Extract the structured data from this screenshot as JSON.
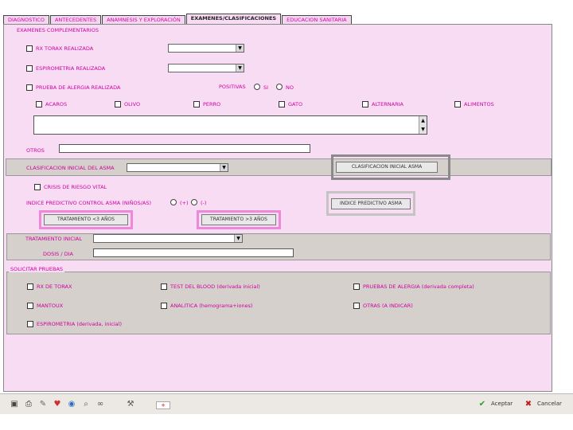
{
  "tabs": [
    {
      "label": "DIAGNOSTICO",
      "active": false
    },
    {
      "label": "ANTECEDENTES",
      "active": false
    },
    {
      "label": "ANAMNESIS Y EXPLORACIÓN",
      "active": false
    },
    {
      "label": "EXAMENES/CLASIFICACIONES",
      "active": true
    },
    {
      "label": "EDUCACION SANITARIA",
      "active": false
    }
  ],
  "examenes": {
    "section_title": "EXAMENES COMPLEMENTARIOS",
    "rx_label": "RX TORAX REALIZADA",
    "espirometria_label": "ESPIROMETRIA REALIZADA",
    "alergia_label": "PRUEBA DE ALERGIA REALIZADA",
    "positivas_label": "POSITIVAS",
    "si_label": "SI",
    "no_label": "NO",
    "alergenos": [
      "ACAROS",
      "OLIVO",
      "PERRO",
      "GATO",
      "ALTERNARIA",
      "ALIMENTOS"
    ],
    "otros_label": "OTROS"
  },
  "clasificacion": {
    "label": "CLASIFICACION INICIAL DEL ASMA",
    "button": "CLASIFICACION INICIAL ASMA",
    "crisis_label": "CRISIS DE RIESGO VITAL",
    "indice_label": "INDICE PREDICTIVO CONTROL ASMA (NIÑOS/AS)",
    "plus_label": "(+)",
    "minus_label": "(-)",
    "indice_button": "INDICE PREDICTIVO ASMA",
    "trat_menores": "TRATAMIENTO <3 AÑOS",
    "trat_mayores": "TRATAMIENTO >3 AÑOS"
  },
  "tratamiento": {
    "label": "TRATAMIENTO INICIAL",
    "dosis_label": "DOSIS / DIA"
  },
  "solicitar": {
    "title": "SOLICITAR PRUEBAS",
    "items": [
      "RX DE TORAX",
      "TEST DEL BLOOD (derivada inicial)",
      "PRUEBAS DE ALERGIA (derivada completa)",
      "MANTOUX",
      "ANALITICA (hemograma+iones)",
      "OTRAS (A INDICAR)",
      "ESPIROMETRIA (derivada, inicial)"
    ]
  },
  "footer": {
    "accept_label": "Aceptar",
    "cancel_label": "Cancelar"
  }
}
